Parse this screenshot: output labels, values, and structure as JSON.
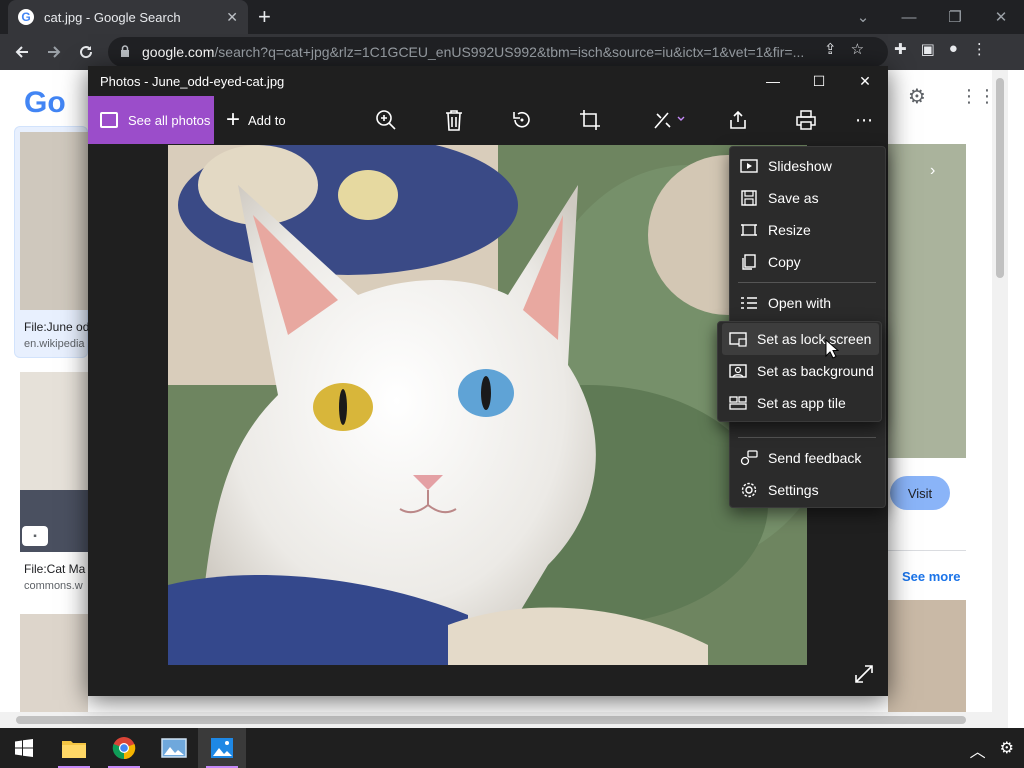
{
  "browser": {
    "tab_title": "cat.jpg - Google Search",
    "tab_favicon": "G",
    "url_host": "google.com",
    "url_rest": "/search?q=cat+jpg&rlz=1C1GCEU_enUS992US992&tbm=isch&source=iu&ictx=1&vet=1&fir=...",
    "icons": [
      "back-icon",
      "forward-icon",
      "reload-icon",
      "lock-icon",
      "share-icon",
      "star-icon",
      "extensions-icon",
      "sidepanel-icon",
      "profile-icon",
      "menu-icon"
    ]
  },
  "google_page": {
    "logo": "Go",
    "results": [
      {
        "title": "File:June od",
        "source": "en.wikipedia"
      },
      {
        "title": "File:Cat Ma",
        "source": "commons.w"
      }
    ],
    "visit_label": "Visit",
    "see_more_label": "See more"
  },
  "photos": {
    "title": "Photos - June_odd-eyed-cat.jpg",
    "see_all_label": "See all photos",
    "add_to_label": "Add to",
    "accent": "#9b4dca",
    "toolbar_icons": [
      "zoom-icon",
      "delete-icon",
      "rotate-icon",
      "crop-icon",
      "edit-icon",
      "share-icon",
      "print-icon",
      "more-icon"
    ]
  },
  "menu": {
    "items": [
      {
        "label": "Slideshow",
        "icon": "slideshow-icon"
      },
      {
        "label": "Save as",
        "icon": "save-icon"
      },
      {
        "label": "Resize",
        "icon": "resize-icon"
      },
      {
        "label": "Copy",
        "icon": "copy-icon"
      },
      {
        "label": "Open with",
        "icon": "open-with-icon"
      },
      {
        "label": "Send feedback",
        "icon": "feedback-icon"
      },
      {
        "label": "Settings",
        "icon": "settings-icon"
      }
    ]
  },
  "submenu": {
    "items": [
      {
        "label": "Set as lock screen",
        "icon": "lock-screen-icon",
        "highlighted": true
      },
      {
        "label": "Set as background",
        "icon": "background-icon",
        "highlighted": false
      },
      {
        "label": "Set as app tile",
        "icon": "app-tile-icon",
        "highlighted": false
      }
    ]
  },
  "taskbar": {
    "apps": [
      "start-icon",
      "file-explorer-icon",
      "chrome-icon",
      "photos-legacy-icon",
      "photos-icon"
    ],
    "active_app": "photos-icon"
  }
}
